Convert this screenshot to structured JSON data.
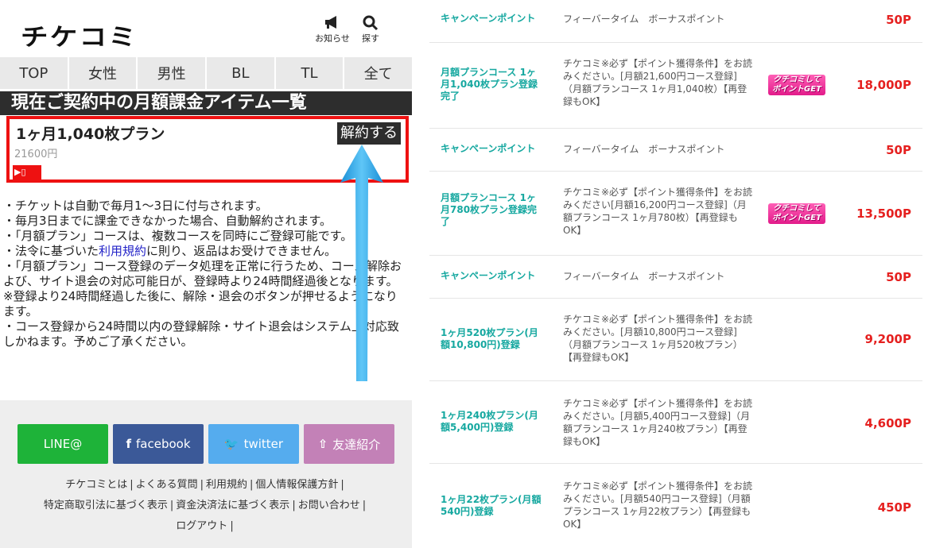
{
  "header": {
    "logo": "チケコミ",
    "news_label": "お知らせ",
    "search_label": "探す"
  },
  "tabs": [
    "TOP",
    "女性",
    "男性",
    "BL",
    "TL",
    "全て"
  ],
  "section_title": "現在ご契約中の月額課金アイテム一覧",
  "plan": {
    "name": "1ヶ月1,040枚プラン",
    "price": "21600円",
    "cancel_label": "解約する"
  },
  "notes": {
    "line1": "・チケットは自動で毎月1〜3日に付与されます。",
    "line2": "・毎月3日までに課金できなかった場合、自動解約されます。",
    "line3": "・「月額プラン」コースは、複数コースを同時にご登録可能です。",
    "line4_pre": "・法令に基づいた",
    "line4_link": "利用規約",
    "line4_post": "に則り、返品はお受けできません。",
    "line5": "・「月額プラン」コース登録のデータ処理を正常に行うため、コース解除および、サイト退会の対応可能日が、登録時より24時間経過後となります。",
    "line6": "※登録より24時間経過した後に、解除・退会のボタンが押せるようになります。",
    "line7": "・コース登録から24時間以内の登録解除・サイト退会はシステム上対応致しかねます。予めご了承ください。"
  },
  "social": {
    "line": "LINE@",
    "facebook": "facebook",
    "twitter": "twitter",
    "invite": "友達紹介"
  },
  "footer_links": {
    "about": "チケコミとは",
    "faq": "よくある質問",
    "terms": "利用規約",
    "privacy": "個人情報保護方針",
    "commerce": "特定商取引法に基づく表示",
    "payment": "資金決済法に基づく表示",
    "contact": "お問い合わせ",
    "logout": "ログアウト"
  },
  "rewards": [
    {
      "title": "キャンペーンポイント",
      "desc": "フィーバータイム　ボーナスポイント",
      "badge": "",
      "points": "50P"
    },
    {
      "title": "月額プランコース 1ヶ月1,040枚プラン登録完了",
      "desc": "チケコミ※必ず【ポイント獲得条件】をお読みください。[月額21,600円コース登録]（月額プランコース 1ヶ月1,040枚）【再登録もOK】",
      "badge": "クチコミして ポイントGET",
      "points": "18,000P"
    },
    {
      "title": "キャンペーンポイント",
      "desc": "フィーバータイム　ボーナスポイント",
      "badge": "",
      "points": "50P"
    },
    {
      "title": "月額プランコース 1ヶ月780枚プラン登録完了",
      "desc": "チケコミ※必ず【ポイント獲得条件】をお読みください[月額16,200円コース登録]（月額プランコース 1ヶ月780枚）【再登録もOK】",
      "badge": "クチコミして ポイントGET",
      "points": "13,500P"
    },
    {
      "title": "キャンペーンポイント",
      "desc": "フィーバータイム　ボーナスポイント",
      "badge": "",
      "points": "50P"
    },
    {
      "title": "1ヶ月520枚プラン(月額10,800円)登録",
      "desc": "チケコミ※必ず【ポイント獲得条件】をお読みください。[月額10,800円コース登録]（月額プランコース 1ヶ月520枚プラン）【再登録もOK】",
      "badge": "",
      "points": "9,200P"
    },
    {
      "title": "1ヶ月240枚プラン(月額5,400円)登録",
      "desc": "チケコミ※必ず【ポイント獲得条件】をお読みください。[月額5,400円コース登録]（月額プランコース 1ヶ月240枚プラン）【再登録もOK】",
      "badge": "",
      "points": "4,600P"
    },
    {
      "title": "1ヶ月22枚プラン(月額540円)登録",
      "desc": "チケコミ※必ず【ポイント獲得条件】をお読みください。[月額540円コース登録]（月額プランコース 1ヶ月22枚プラン）【再登録もOK】",
      "badge": "",
      "points": "450P"
    }
  ],
  "colors": {
    "accent_teal": "#16a8a0",
    "points_red": "#e5201f",
    "highlight_border": "#ee1111",
    "arrow_blue": "#2aa4e6"
  }
}
